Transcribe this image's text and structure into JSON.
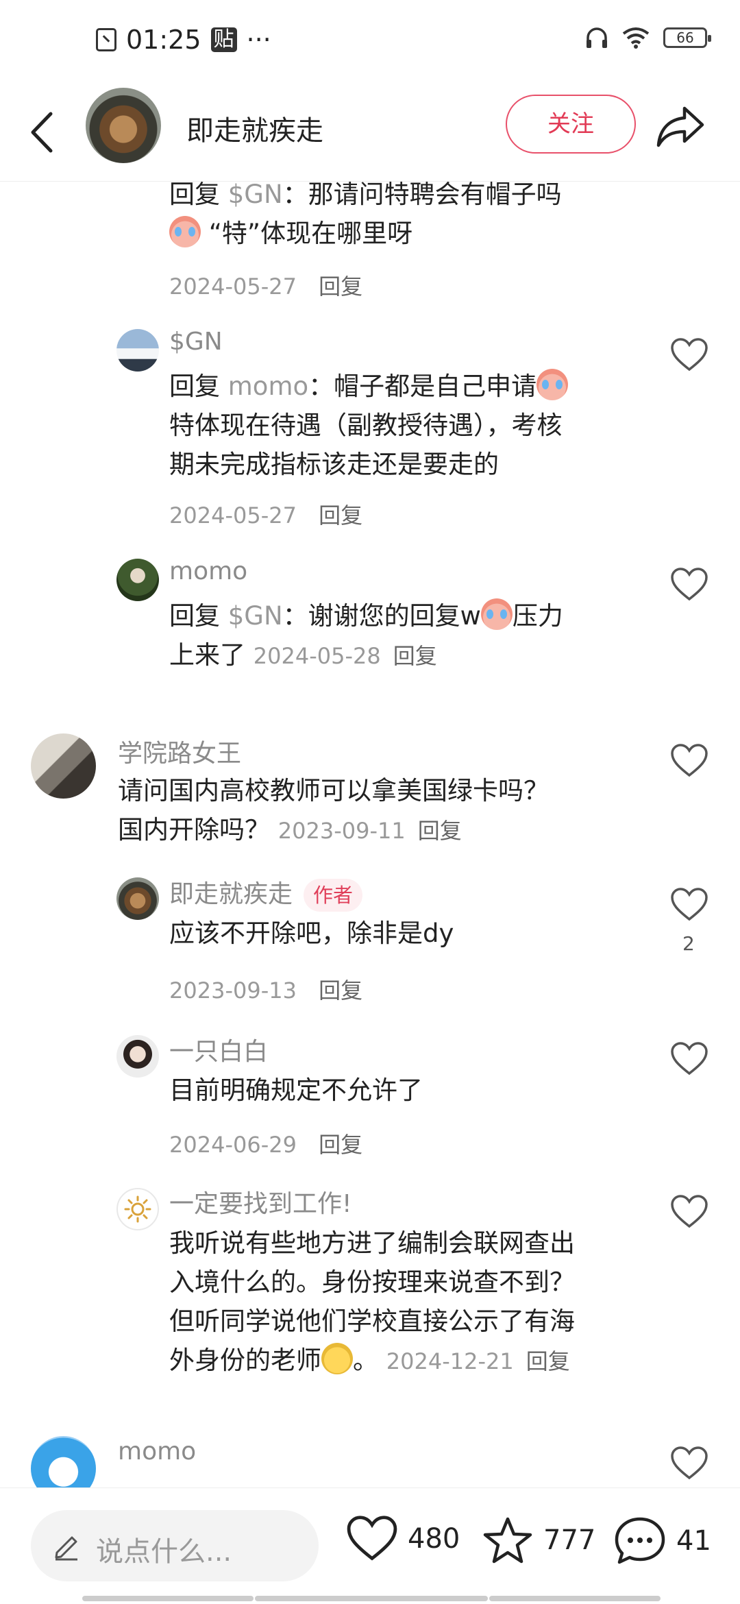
{
  "status": {
    "time": "01:25",
    "tie": "贴",
    "dots": "···",
    "battery": "66"
  },
  "header": {
    "name": "即走就疾走",
    "follow": "关注"
  },
  "comments": {
    "c1": {
      "prefix": "回复",
      "target": "$GN",
      "sep": "：",
      "text1": "那请问特聘会有帽子吗",
      "text2": "“特”体现在哪里呀",
      "date": "2024-05-27",
      "reply": "回复"
    },
    "c2": {
      "name": "$GN",
      "prefix": "回复",
      "target": "momo",
      "sep": "：",
      "text1": "帽子都是自己申请",
      "text2": "特体现在待遇（副教授待遇），考核",
      "text3": "期未完成指标该走还是要走的",
      "date": "2024-05-27",
      "reply": "回复"
    },
    "c3": {
      "name": "momo",
      "prefix": "回复",
      "target": "$GN",
      "sep": "：",
      "text1": "谢谢您的回复w",
      "text1b": "压力",
      "text2": "上来了",
      "date": "2024-05-28",
      "reply": "回复"
    },
    "c4": {
      "name": "学院路女王",
      "text1": "请问国内高校教师可以拿美国绿卡吗？",
      "text2": "国内开除吗？",
      "date": "2023-09-11",
      "reply": "回复"
    },
    "c5": {
      "name": "即走就疾走",
      "tag": "作者",
      "text1": "应该不开除吧，除非是dy",
      "date": "2023-09-13",
      "reply": "回复",
      "likes": "2"
    },
    "c6": {
      "name": "一只白白",
      "text1": "目前明确规定不允许了",
      "date": "2024-06-29",
      "reply": "回复"
    },
    "c7": {
      "name": "一定要找到工作!",
      "text1": "我听说有些地方进了编制会联网查出",
      "text2": "入境什么的。身份按理来说查不到？",
      "text3": "但听同学说他们学校直接公示了有海",
      "text4": "外身份的老师",
      "text4b": "。",
      "date": "2024-12-21",
      "reply": "回复"
    },
    "c8": {
      "name": "momo"
    }
  },
  "bottom": {
    "placeholder": "说点什么...",
    "likes": "480",
    "favorites": "777",
    "comments": "41"
  }
}
